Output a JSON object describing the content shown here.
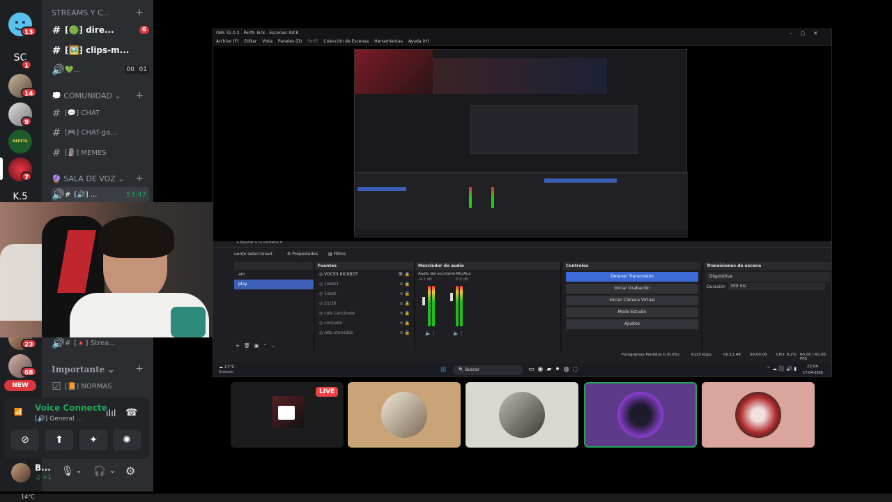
{
  "servers": [
    {
      "name": "blue-face-server",
      "badge": "13"
    },
    {
      "name": "sc-server",
      "label": "SC",
      "badge": "1"
    },
    {
      "name": "photo-server-1",
      "badge": "14"
    },
    {
      "name": "photo-server-2",
      "badge": "9"
    },
    {
      "name": "hepe-server",
      "label": "HEPETA LORD",
      "badge": ""
    },
    {
      "name": "red-server",
      "badge": "7"
    },
    {
      "name": "k5-server",
      "label": "K.5",
      "badge": ""
    },
    {
      "name": "photo-server-3",
      "badge": "23"
    },
    {
      "name": "photo-server-4",
      "badge": "68"
    }
  ],
  "new_label": "NEW",
  "channels": {
    "cat_streams": "STREAMS Y C...",
    "direct": "⁅🟢⁆ dire...",
    "direct_badge": "6",
    "clips": "⁅🖼️⁆ clips-m...",
    "voice_heart": "💚...",
    "voice_heart_time_a": "00",
    "voice_heart_time_b": "01",
    "cat_comunidad": "COMUNIDAD",
    "chat": "⁅💬⁆ CHAT",
    "chat_gaming": "⁅🎮⁆ CHAT-ga...",
    "memes": "⁅🗿⁆ MEMES",
    "cat_voz": "SALA DE VOZ",
    "voice_general": "⁅🔊⁆ ...",
    "voice_general_time": "53:47",
    "stream_channel": "⁅🔺⁆ Strea...",
    "cat_importante": "Importante",
    "normas": "⁅📙⁆ NORMAS"
  },
  "voice": {
    "status": "Voice Connecte",
    "channel": "⁅🔊⁆ General ..."
  },
  "user": {
    "name": "B...",
    "status": "+1"
  },
  "obs": {
    "title": "OBS 32.0.2 - Perfil: kick - Escenas: KICK",
    "menu": [
      "Archivo (F)",
      "Editar",
      "Vista",
      "Paneles (D)",
      "Perfil",
      "Colección de Escenas",
      "Herramientas",
      "Ayuda (H)"
    ],
    "preview_caption": "Ajustar a la ventana",
    "source_label": "uente seleccionad",
    "props_tab": "Propiedades",
    "filters_tab": "Filtros",
    "scenes_header": "",
    "scenes": [
      "am",
      "play"
    ],
    "sources_header": "Fuentes",
    "sources": [
      "VOCES KICKBOT",
      "1xbet1",
      "1xbet",
      "21/30",
      "cola canciones",
      "contador",
      "reto xtensible"
    ],
    "mixer_header": "Mezclador de audio",
    "mixer_channels": [
      {
        "name": "Audio del escritorio",
        "level": "-9.2 dB"
      },
      {
        "name": "Mic/Aux",
        "level": "0.0 dB"
      }
    ],
    "controls_header": "Controles",
    "controls": [
      "Detener Transmisión",
      "Iniciar Grabación",
      "Iniciar Cámara Virtual",
      "Modo Estudio",
      "Ajustes"
    ],
    "transitions_header": "Transiciones de escena",
    "transition": "Dispositiva",
    "duration_label": "Duración",
    "duration_value": "300 ms",
    "status_frames": "Fotogramas Perdidos 0 (0.0%)",
    "status_kbps": "6125 kbps",
    "status_time1": "00:11:49",
    "status_time2": "00:00:00",
    "status_cpu": "CPU: 9.2%",
    "status_fps": "60.00 / 60.00 FPS",
    "taskbar_weather": "17°C",
    "taskbar_weather2": "Nublado",
    "taskbar_search": "Buscar",
    "taskbar_time": "22:04",
    "taskbar_date": "17-04-2026"
  },
  "tiles": [
    {
      "name": "stream-tile",
      "live": "LIVE",
      "color": "#222"
    },
    {
      "name": "user-tile-1",
      "color": "#c8a477"
    },
    {
      "name": "user-tile-2",
      "color": "#d8d8d0"
    },
    {
      "name": "user-tile-3",
      "color": "#5d3a8a"
    },
    {
      "name": "user-tile-4",
      "color": "#d9a59c"
    }
  ],
  "bottom_weather": "14°C"
}
